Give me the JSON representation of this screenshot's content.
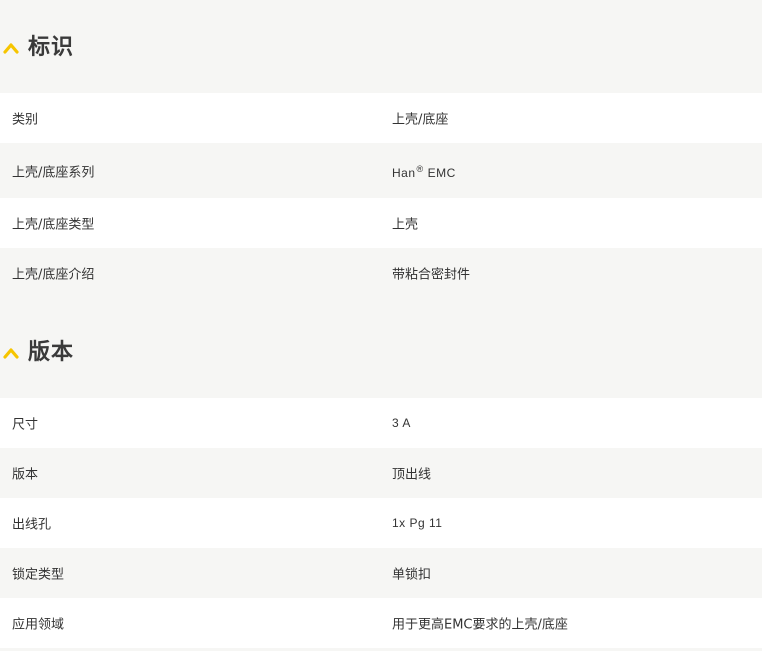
{
  "colors": {
    "accent": "#f6c500",
    "background": "#f6f6f4",
    "row_white": "#ffffff",
    "text": "#333333"
  },
  "sections": {
    "identification": {
      "title": "标识",
      "icon": "chevron-up-icon",
      "rows": [
        {
          "label": "类别",
          "value": "上壳/底座"
        },
        {
          "label": "上壳/底座系列",
          "value_prefix": "Han",
          "value_mark": "®",
          "value_suffix": "EMC"
        },
        {
          "label": "上壳/底座类型",
          "value": "上壳"
        },
        {
          "label": "上壳/底座介绍",
          "value": "带粘合密封件"
        }
      ]
    },
    "version": {
      "title": "版本",
      "icon": "chevron-up-icon",
      "rows": [
        {
          "label": "尺寸",
          "value": "3 A"
        },
        {
          "label": "版本",
          "value": "顶出线"
        },
        {
          "label": "出线孔",
          "value": "1x Pg 11"
        },
        {
          "label": "锁定类型",
          "value": "单锁扣"
        },
        {
          "label": "应用领域",
          "value": "用于更高EMC要求的上壳/底座"
        }
      ]
    }
  }
}
